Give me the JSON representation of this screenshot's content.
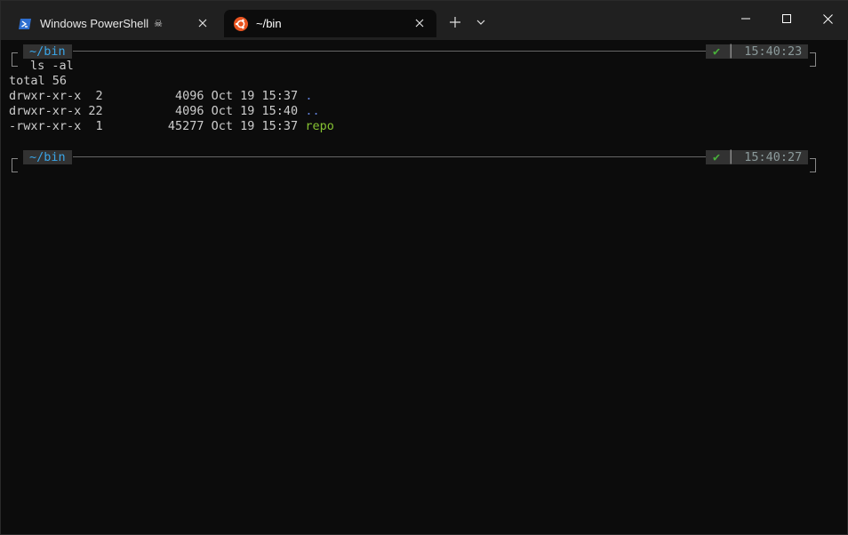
{
  "titlebar": {
    "tabs": [
      {
        "label": "Windows PowerShell",
        "icon": "powershell-icon",
        "badge": "☠",
        "active": false
      },
      {
        "label": "~/bin",
        "icon": "ubuntu-icon",
        "active": true
      }
    ],
    "new_tab": "+",
    "window_buttons": [
      "minimize",
      "maximize",
      "close"
    ]
  },
  "terminal": {
    "prompt1": {
      "cwd": "~/bin",
      "status": "✔",
      "time": "15:40:23",
      "command": "ls -al"
    },
    "output": {
      "total": "total 56",
      "rows": [
        {
          "perms": "drwxr-xr-x",
          "links": " 2",
          "size": "4096",
          "date": "Oct 19 15:37",
          "name": "."
        },
        {
          "perms": "drwxr-xr-x",
          "links": "22",
          "size": "4096",
          "date": "Oct 19 15:40",
          "name": ".."
        },
        {
          "perms": "-rwxr-xr-x",
          "links": " 1",
          "size": "45277",
          "date": "Oct 19 15:37",
          "name": "repo"
        }
      ]
    },
    "prompt2": {
      "cwd": "~/bin",
      "status": "✔",
      "time": "15:40:27"
    }
  },
  "colors": {
    "bg": "#0c0c0c",
    "titlebar": "#202020",
    "cwd": "#3aa6e8",
    "ok": "#48b03a",
    "exec": "#86c232",
    "dir": "#5f7fd6"
  }
}
